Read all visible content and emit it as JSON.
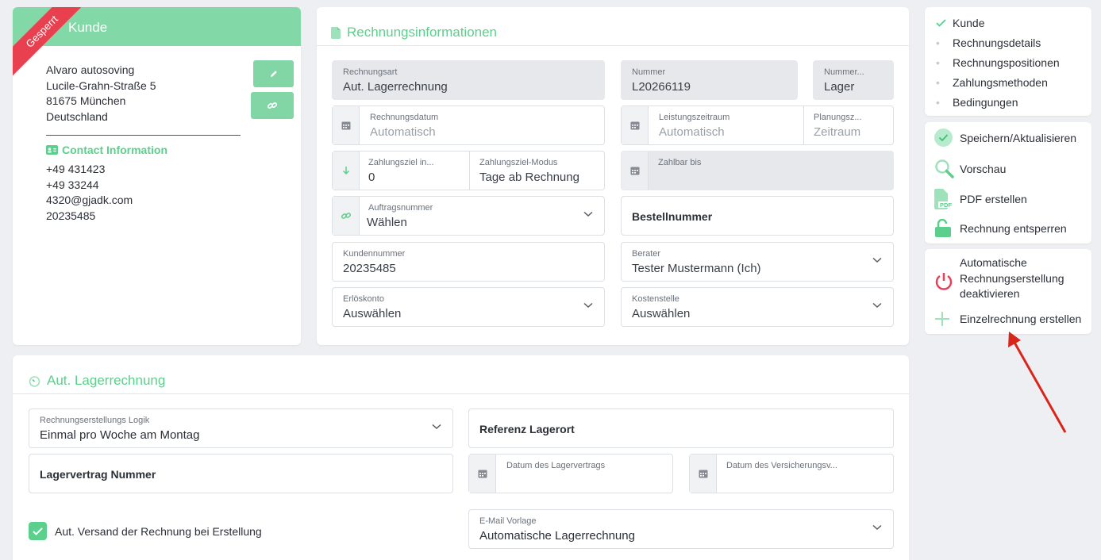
{
  "customer": {
    "header": "Kunde",
    "ribbon": "Gesperrt",
    "address": [
      "Alvaro autosoving",
      "Lucile-Grahn-Straße 5",
      "81675 München",
      "Deutschland"
    ],
    "contact_title": "Contact Information",
    "contact": [
      "+49 431423",
      "+49 33244",
      "4320@gjadk.com",
      "20235485"
    ]
  },
  "invoice": {
    "title": "Rechnungsinformationen",
    "rechnungsart": {
      "label": "Rechnungsart",
      "value": "Aut. Lagerrechnung"
    },
    "nummer": {
      "label": "Nummer",
      "value": "L20266119"
    },
    "nummernkreis": {
      "label": "Nummer...",
      "value": "Lager"
    },
    "rechnungsdatum": {
      "label": "Rechnungsdatum",
      "value": "Automatisch"
    },
    "leistungszeitraum": {
      "label": "Leistungszeitraum",
      "value": "Automatisch"
    },
    "planungszeitraum": {
      "label": "Planungsz...",
      "value": "Zeitraum"
    },
    "zahlungsziel": {
      "label": "Zahlungsziel in...",
      "value": "0"
    },
    "zahlungsziel_modus": {
      "label": "Zahlungsziel-Modus",
      "value": "Tage ab Rechnung"
    },
    "zahlbar_bis": {
      "label": "Zahlbar bis",
      "value": ""
    },
    "auftragsnummer": {
      "label": "Auftragsnummer",
      "value": "Wählen"
    },
    "bestellnummer": {
      "label": "Bestellnummer"
    },
    "kundennummer": {
      "label": "Kundennummer",
      "value": "20235485"
    },
    "berater": {
      "label": "Berater",
      "value": "Tester Mustermann (Ich)"
    },
    "erloeskonto": {
      "label": "Erlöskonto",
      "value": "Auswählen"
    },
    "kostenstelle": {
      "label": "Kostenstelle",
      "value": "Auswählen"
    }
  },
  "steps": [
    "Kunde",
    "Rechnungsdetails",
    "Rechnungspositionen",
    "Zahlungsmethoden",
    "Bedingungen"
  ],
  "actions": [
    "Speichern/Aktualisieren",
    "Vorschau",
    "PDF erstellen",
    "Rechnung entsperren"
  ],
  "actions2": {
    "deactivate": [
      "Automatische",
      "Rechnungserstellung",
      "deaktivieren"
    ],
    "single": "Einzelrechnung erstellen"
  },
  "lager": {
    "title": "Aut. Lagerrechnung",
    "logik": {
      "label": "Rechnungserstellungs Logik",
      "value": "Einmal pro Woche am Montag"
    },
    "referenz": "Referenz Lagerort",
    "vertrag_nummer": "Lagervertrag Nummer",
    "datum_vertrag": "Datum des Lagervertrags",
    "datum_versicherung": "Datum des Versicherungsv...",
    "versand": "Aut. Versand der Rechnung bei Erstellung",
    "email_vorlage": {
      "label": "E-Mail Vorlage",
      "value": "Automatische Lagerrechnung"
    }
  },
  "colors": {
    "accent": "#5ccf8c",
    "ribbon": "#e8404f",
    "power": "#e8405a",
    "arrow": "#d9261c"
  }
}
